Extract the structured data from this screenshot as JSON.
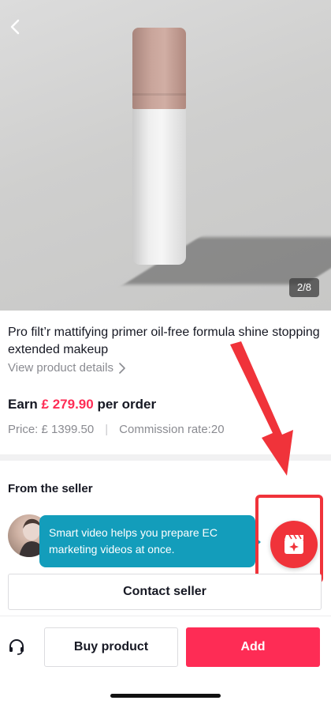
{
  "gallery": {
    "counter": "2/8"
  },
  "product": {
    "title": "Pro filt’r mattifying primer oil-free formula shine stopping extended makeup",
    "details_link": "View product details"
  },
  "earnings": {
    "prefix": "Earn",
    "amount": "£ 279.90",
    "suffix": "per order",
    "price": "Price: £ 1399.50",
    "commission": "Commission rate:20"
  },
  "seller": {
    "section_title": "From the seller",
    "tooltip_text": "Smart video helps you prepare EC marketing videos at once.",
    "contact_button": "Contact seller"
  },
  "bottom_bar": {
    "buy_button": "Buy product",
    "add_button": "Add"
  },
  "colors": {
    "accent": "#fe2c55",
    "tooltip": "#139dbb",
    "highlight": "#f0333a"
  },
  "icons": [
    "back-chevron-icon",
    "chevron-right-icon",
    "smart-video-icon",
    "headset-icon"
  ]
}
